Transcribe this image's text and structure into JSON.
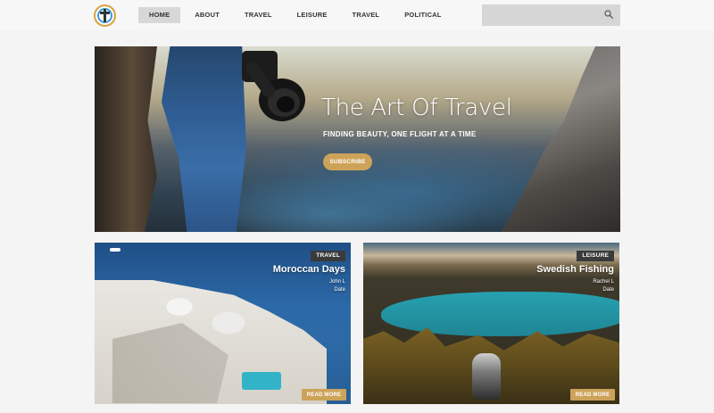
{
  "header": {
    "nav": [
      "HOME",
      "ABOUT",
      "TRAVEL",
      "LEISURE",
      "TRAVEL",
      "POLITICAL"
    ],
    "active_index": 0,
    "search": {
      "value": "",
      "placeholder": ""
    }
  },
  "hero": {
    "title": "The Art Of Travel",
    "subtitle": "FINDING BEAUTY, ONE FLIGHT AT A TIME",
    "button": "SUBSCRIBE"
  },
  "cards": [
    {
      "tag": "TRAVEL",
      "title": "Moroccan Days",
      "author": "John L",
      "date": "Date",
      "button": "READ MORE"
    },
    {
      "tag": "LEISURE",
      "title": "Swedish Fishing",
      "author": "Rachel L",
      "date": "Date",
      "button": "READ MORE"
    }
  ],
  "colors": {
    "accent": "#cda35a",
    "tag_bg": "#3a3a3a",
    "nav_active_bg": "#d7d7d7"
  },
  "icons": {
    "search": "search-icon",
    "logo": "compass-logo-icon"
  }
}
